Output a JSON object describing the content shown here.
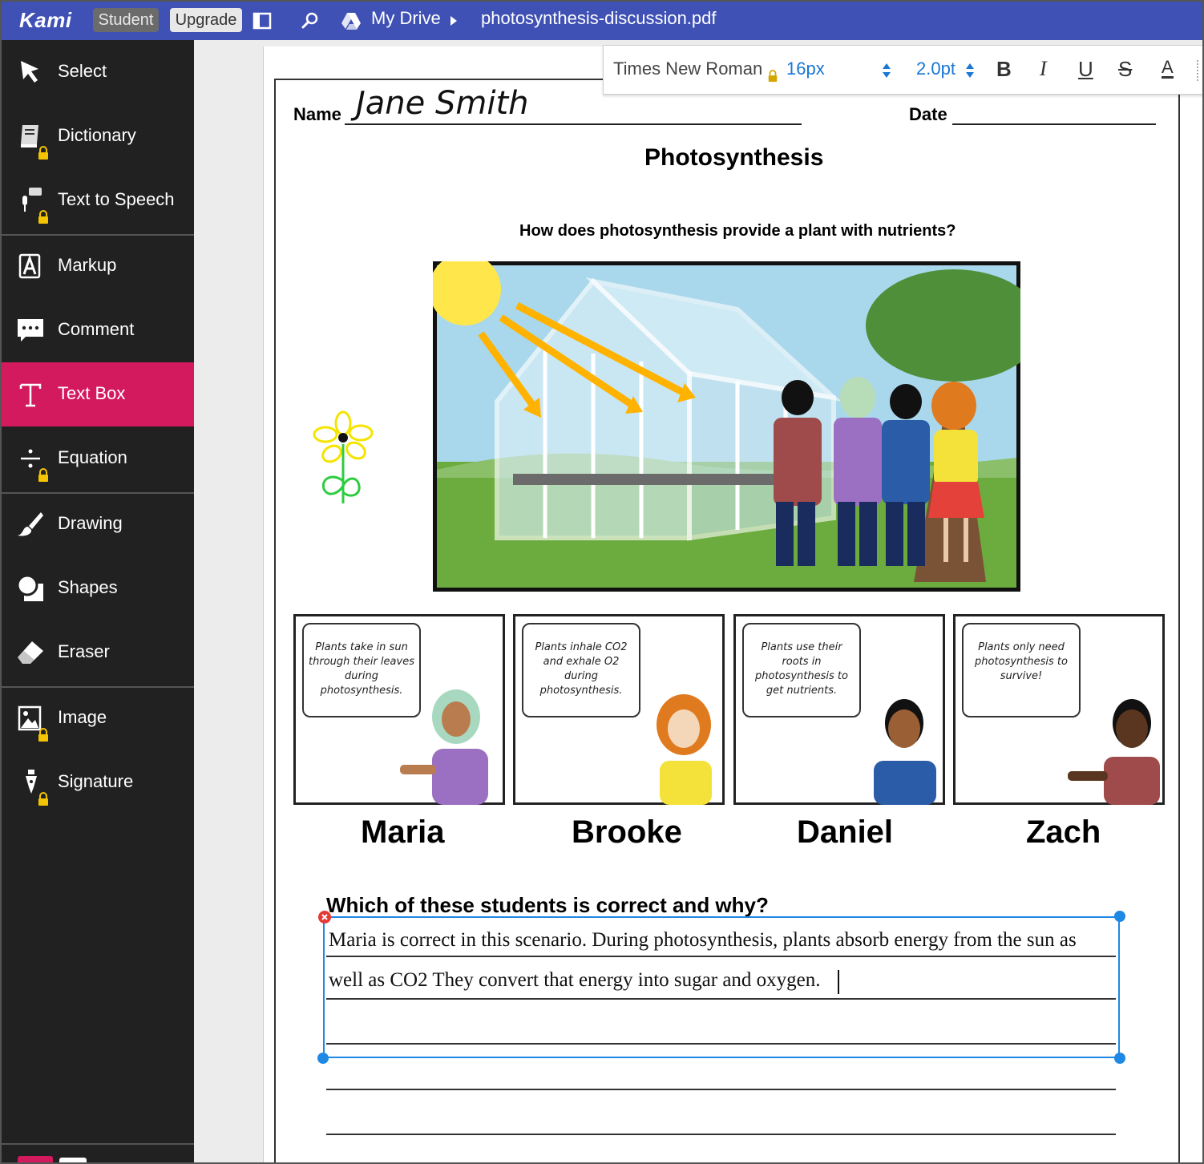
{
  "topbar": {
    "logo": "Kami",
    "role_badge": "Student",
    "upgrade_label": "Upgrade",
    "breadcrumb_drive": "My Drive",
    "filename": "photosynthesis-discussion.pdf",
    "color": "#3f51b5"
  },
  "sidebar": {
    "active_color": "#d41a5f",
    "items": [
      {
        "label": "Select",
        "icon": "cursor-arrow-icon",
        "locked": false,
        "active": false
      },
      {
        "label": "Dictionary",
        "icon": "book-icon",
        "locked": true,
        "active": false
      },
      {
        "label": "Text to Speech",
        "icon": "speech-icon",
        "locked": true,
        "active": false
      },
      {
        "label": "Markup",
        "icon": "markup-icon",
        "locked": false,
        "active": false
      },
      {
        "label": "Comment",
        "icon": "comment-icon",
        "locked": false,
        "active": false
      },
      {
        "label": "Text Box",
        "icon": "text-box-icon",
        "locked": false,
        "active": true
      },
      {
        "label": "Equation",
        "icon": "equation-icon",
        "locked": true,
        "active": false
      },
      {
        "label": "Drawing",
        "icon": "brush-icon",
        "locked": false,
        "active": false
      },
      {
        "label": "Shapes",
        "icon": "shapes-icon",
        "locked": false,
        "active": false
      },
      {
        "label": "Eraser",
        "icon": "eraser-icon",
        "locked": false,
        "active": false
      },
      {
        "label": "Image",
        "icon": "image-icon",
        "locked": true,
        "active": false
      },
      {
        "label": "Signature",
        "icon": "pen-nib-icon",
        "locked": true,
        "active": false
      }
    ]
  },
  "format_toolbar": {
    "font_family": "Times New Roman",
    "font_size": "16px",
    "line_width": "2.0pt",
    "bold": "B",
    "italic": "I",
    "underline": "U",
    "strikethrough": "S",
    "font_color": "A"
  },
  "document": {
    "name_label": "Name",
    "name_value": "Jane Smith",
    "date_label": "Date",
    "title": "Photosynthesis",
    "question": "How does photosynthesis provide a plant with nutrients?",
    "cards": [
      {
        "name": "Maria",
        "speech": "Plants take in sun through their leaves during photosynthesis."
      },
      {
        "name": "Brooke",
        "speech": "Plants inhale CO2 and exhale O2 during photosynthesis."
      },
      {
        "name": "Daniel",
        "speech": "Plants use their roots in photosynthesis to get nutrients."
      },
      {
        "name": "Zach",
        "speech": "Plants only need photosynthesis to survive!"
      }
    ],
    "prompt": "Which of these students is correct and why?",
    "answer_line1": "Maria is correct in this scenario. During photosynthesis, plants absorb energy from the sun as",
    "answer_line2": "well as CO2  They convert that energy into sugar and oxygen."
  }
}
